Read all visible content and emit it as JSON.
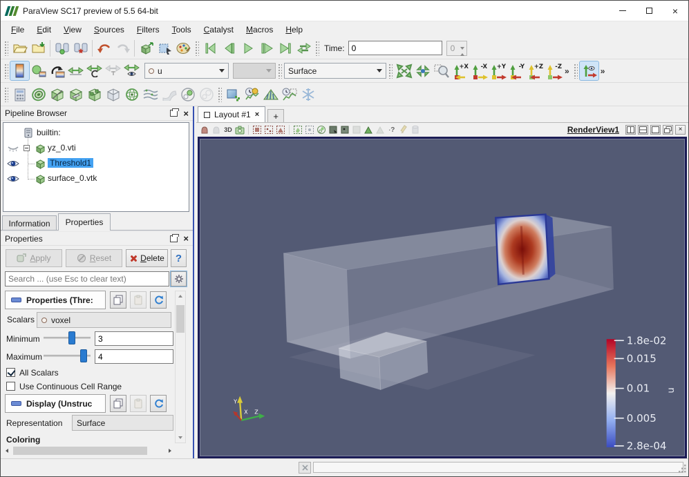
{
  "titlebar": {
    "title": "ParaView SC17 preview of 5.5 64-bit"
  },
  "glyphs": {
    "overflow": "»",
    "close": "×"
  },
  "menus": [
    "File",
    "Edit",
    "View",
    "Sources",
    "Filters",
    "Tools",
    "Catalyst",
    "Macros",
    "Help"
  ],
  "toolbar": {
    "time_label": "Time:",
    "time_value": "0",
    "time_step": "0",
    "array_value": "u",
    "representation_value": "Surface",
    "mode_3d": "3D",
    "axis_buttons": [
      "+X",
      "-X",
      "+Y",
      "-Y",
      "+Z",
      "-Z"
    ]
  },
  "pipeline": {
    "title": "Pipeline Browser",
    "items": [
      {
        "label": "builtin:"
      },
      {
        "label": "yz_0.vti"
      },
      {
        "label": "Threshold1"
      },
      {
        "label": "surface_0.vtk"
      }
    ]
  },
  "dock_tabs": {
    "information": "Information",
    "properties": "Properties"
  },
  "properties": {
    "title": "Properties",
    "apply_label": "Apply",
    "reset_label": "Reset",
    "delete_label": "Delete",
    "help_label": "?",
    "search_placeholder": "Search ... (use Esc to clear text)",
    "section_properties_label": "Properties (Thre:",
    "section_display_label": "Display (Unstruc",
    "scalars_label": "Scalars",
    "scalars_value": "voxel",
    "minimum_label": "Minimum",
    "minimum_value": "3",
    "maximum_label": "Maximum",
    "maximum_value": "4",
    "all_scalars_label": "All Scalars",
    "continuous_label": "Use Continuous Cell Range",
    "representation_label": "Representation",
    "representation_value": "Surface",
    "coloring_label": "Coloring"
  },
  "layout": {
    "tab_label": "Layout #1",
    "add_tab": "+",
    "view_name": "RenderView1"
  },
  "scene": {
    "legend_title": "u",
    "legend_ticks": [
      "1.8e-02",
      "0.015",
      "0.01",
      "0.005",
      "2.8e-04"
    ],
    "axis_x": "X",
    "axis_y": "Y",
    "axis_z": "Z",
    "colors": {
      "viewport_bg": "#535A74",
      "viewport_border": "#1B1C55",
      "legend_top": "#B40426",
      "legend_bottom": "#3B4CC0",
      "selection_blue": "#44A2F2"
    }
  }
}
